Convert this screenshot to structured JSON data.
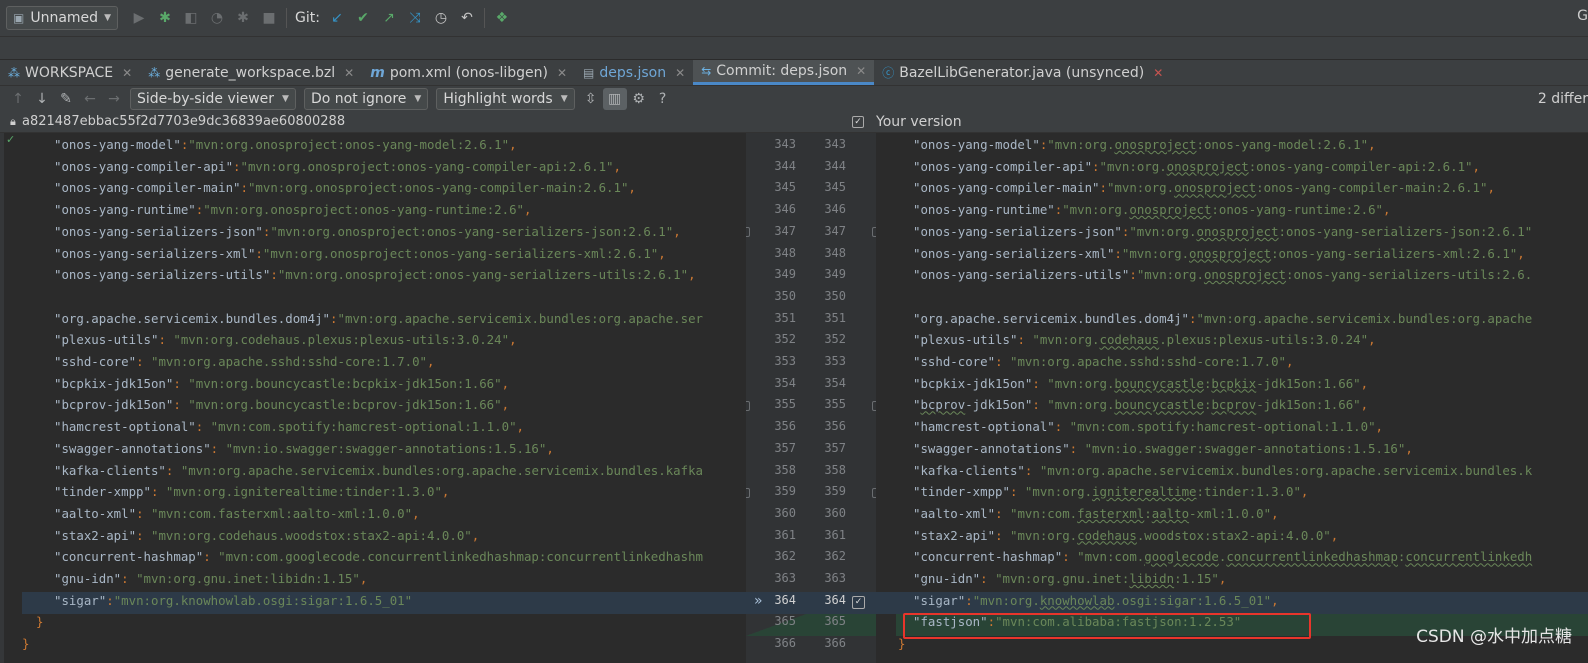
{
  "toolbar": {
    "run_config": "Unnamed",
    "git_label": "Git:"
  },
  "tabs": [
    {
      "label": "WORKSPACE",
      "icon": "bazel-icon",
      "active": false
    },
    {
      "label": "generate_workspace.bzl",
      "icon": "bazel-icon",
      "active": false
    },
    {
      "label": "pom.xml (onos-libgen)",
      "icon": "maven-icon",
      "active": false
    },
    {
      "label": "deps.json",
      "icon": "json-icon",
      "active": false
    },
    {
      "label": "Commit: deps.json",
      "icon": "diff-icon",
      "active": true
    },
    {
      "label": "BazelLibGenerator.java (unsynced)",
      "icon": "java-class-icon",
      "active": false
    }
  ],
  "diff_toolbar": {
    "viewer": "Side-by-side viewer",
    "ignore": "Do not ignore",
    "highlight": "Highlight words",
    "help": "?",
    "differences": "2 differ"
  },
  "panes": {
    "left_title": "a821487ebbac55f2d7703e9dc36839ae60800288",
    "right_title": "Your version"
  },
  "left_lines": [
    [
      [
        "k",
        "\"onos-yang-model\""
      ],
      [
        "p",
        ":"
      ],
      [
        "s",
        "\"mvn:org.onosproject:onos-yang-model:2.6.1\""
      ],
      [
        "p",
        ","
      ]
    ],
    [
      [
        "k",
        "\"onos-yang-compiler-api\""
      ],
      [
        "p",
        ":"
      ],
      [
        "s",
        "\"mvn:org.onosproject:onos-yang-compiler-api:2.6.1\""
      ],
      [
        "p",
        ","
      ]
    ],
    [
      [
        "k",
        "\"onos-yang-compiler-main\""
      ],
      [
        "p",
        ":"
      ],
      [
        "s",
        "\"mvn:org.onosproject:onos-yang-compiler-main:2.6.1\""
      ],
      [
        "p",
        ","
      ]
    ],
    [
      [
        "k",
        "\"onos-yang-runtime\""
      ],
      [
        "p",
        ":"
      ],
      [
        "s",
        "\"mvn:org.onosproject:onos-yang-runtime:2.6\""
      ],
      [
        "p",
        ","
      ]
    ],
    [
      [
        "k",
        "\"onos-yang-serializers-json\""
      ],
      [
        "p",
        ":"
      ],
      [
        "s",
        "\"mvn:org.onosproject:onos-yang-serializers-json:2.6.1\""
      ],
      [
        "p",
        ","
      ]
    ],
    [
      [
        "k",
        "\"onos-yang-serializers-xml\""
      ],
      [
        "p",
        ":"
      ],
      [
        "s",
        "\"mvn:org.onosproject:onos-yang-serializers-xml:2.6.1\""
      ],
      [
        "p",
        ","
      ]
    ],
    [
      [
        "k",
        "\"onos-yang-serializers-utils\""
      ],
      [
        "p",
        ":"
      ],
      [
        "s",
        "\"mvn:org.onosproject:onos-yang-serializers-utils:2.6.1\""
      ],
      [
        "p",
        ","
      ]
    ],
    [],
    [
      [
        "k",
        "\"org.apache.servicemix.bundles.dom4j\""
      ],
      [
        "p",
        ":"
      ],
      [
        "s",
        "\"mvn:org.apache.servicemix.bundles:org.apache.ser"
      ]
    ],
    [
      [
        "k",
        "\"plexus-utils\""
      ],
      [
        "p",
        ": "
      ],
      [
        "s",
        "\"mvn:org.codehaus.plexus:plexus-utils:3.0.24\""
      ],
      [
        "p",
        ","
      ]
    ],
    [
      [
        "k",
        "\"sshd-core\""
      ],
      [
        "p",
        ": "
      ],
      [
        "s",
        "\"mvn:org.apache.sshd:sshd-core:1.7.0\""
      ],
      [
        "p",
        ","
      ]
    ],
    [
      [
        "k",
        "\"bcpkix-jdk15on\""
      ],
      [
        "p",
        ": "
      ],
      [
        "s",
        "\"mvn:org.bouncycastle:bcpkix-jdk15on:1.66\""
      ],
      [
        "p",
        ","
      ]
    ],
    [
      [
        "k",
        "\"bcprov-jdk15on\""
      ],
      [
        "p",
        ": "
      ],
      [
        "s",
        "\"mvn:org.bouncycastle:bcprov-jdk15on:1.66\""
      ],
      [
        "p",
        ","
      ]
    ],
    [
      [
        "k",
        "\"hamcrest-optional\""
      ],
      [
        "p",
        ": "
      ],
      [
        "s",
        "\"mvn:com.spotify:hamcrest-optional:1.1.0\""
      ],
      [
        "p",
        ","
      ]
    ],
    [
      [
        "k",
        "\"swagger-annotations\""
      ],
      [
        "p",
        ": "
      ],
      [
        "s",
        "\"mvn:io.swagger:swagger-annotations:1.5.16\""
      ],
      [
        "p",
        ","
      ]
    ],
    [
      [
        "k",
        "\"kafka-clients\""
      ],
      [
        "p",
        ": "
      ],
      [
        "s",
        "\"mvn:org.apache.servicemix.bundles:org.apache.servicemix.bundles.kafka"
      ]
    ],
    [
      [
        "k",
        "\"tinder-xmpp\""
      ],
      [
        "p",
        ": "
      ],
      [
        "s",
        "\"mvn:org.igniterealtime:tinder:1.3.0\""
      ],
      [
        "p",
        ","
      ]
    ],
    [
      [
        "k",
        "\"aalto-xml\""
      ],
      [
        "p",
        ": "
      ],
      [
        "s",
        "\"mvn:com.fasterxml:aalto-xml:1.0.0\""
      ],
      [
        "p",
        ","
      ]
    ],
    [
      [
        "k",
        "\"stax2-api\""
      ],
      [
        "p",
        ": "
      ],
      [
        "s",
        "\"mvn:org.codehaus.woodstox:stax2-api:4.0.0\""
      ],
      [
        "p",
        ","
      ]
    ],
    [
      [
        "k",
        "\"concurrent-hashmap\""
      ],
      [
        "p",
        ": "
      ],
      [
        "s",
        "\"mvn:com.googlecode.concurrentlinkedhashmap:concurrentlinkedhashm"
      ]
    ],
    [
      [
        "k",
        "\"gnu-idn\""
      ],
      [
        "p",
        ": "
      ],
      [
        "s",
        "\"mvn:org.gnu.inet:libidn:1.15\""
      ],
      [
        "p",
        ","
      ]
    ],
    [
      [
        "k",
        "\"sigar\""
      ],
      [
        "p",
        ":"
      ],
      [
        "s",
        "\"mvn:org.knowhowlab.osgi:sigar:1.6.5_01\""
      ]
    ],
    [
      [
        "p",
        "}"
      ]
    ],
    [
      [
        "p",
        "}"
      ]
    ]
  ],
  "right_lines": [
    [
      [
        "k",
        "\"onos-yang-model\""
      ],
      [
        "p",
        ":"
      ],
      [
        "s",
        "\"mvn:org."
      ],
      [
        "su",
        "onosproject"
      ],
      [
        "s",
        ":onos-yang-model:2.6.1\""
      ],
      [
        "p",
        ","
      ]
    ],
    [
      [
        "k",
        "\"onos-yang-compiler-api\""
      ],
      [
        "p",
        ":"
      ],
      [
        "s",
        "\"mvn:org."
      ],
      [
        "su",
        "onosproject"
      ],
      [
        "s",
        ":onos-yang-compiler-api:2.6.1\""
      ],
      [
        "p",
        ","
      ]
    ],
    [
      [
        "k",
        "\"onos-yang-compiler-main\""
      ],
      [
        "p",
        ":"
      ],
      [
        "s",
        "\"mvn:org."
      ],
      [
        "su",
        "onosproject"
      ],
      [
        "s",
        ":onos-yang-compiler-main:2.6.1\""
      ],
      [
        "p",
        ","
      ]
    ],
    [
      [
        "k",
        "\"onos-yang-runtime\""
      ],
      [
        "p",
        ":"
      ],
      [
        "s",
        "\"mvn:org."
      ],
      [
        "su",
        "onosproject"
      ],
      [
        "s",
        ":onos-yang-runtime:2.6\""
      ],
      [
        "p",
        ","
      ]
    ],
    [
      [
        "k",
        "\"onos-yang-serializers-json\""
      ],
      [
        "p",
        ":"
      ],
      [
        "s",
        "\"mvn:org."
      ],
      [
        "su",
        "onosproject"
      ],
      [
        "s",
        ":onos-yang-serializers-json:2.6.1\""
      ]
    ],
    [
      [
        "k",
        "\"onos-yang-serializers-xml\""
      ],
      [
        "p",
        ":"
      ],
      [
        "s",
        "\"mvn:org."
      ],
      [
        "su",
        "onosproject"
      ],
      [
        "s",
        ":onos-yang-serializers-xml:2.6.1\""
      ],
      [
        "p",
        ","
      ]
    ],
    [
      [
        "k",
        "\"onos-yang-serializers-utils\""
      ],
      [
        "p",
        ":"
      ],
      [
        "s",
        "\"mvn:org."
      ],
      [
        "su",
        "onosproject"
      ],
      [
        "s",
        ":onos-yang-serializers-utils:2.6."
      ]
    ],
    [],
    [
      [
        "k",
        "\"org.apache.servicemix.bundles.dom4j\""
      ],
      [
        "p",
        ":"
      ],
      [
        "s",
        "\"mvn:org.apache.servicemix.bundles:org.apache"
      ]
    ],
    [
      [
        "k",
        "\"plexus-utils\""
      ],
      [
        "p",
        ": "
      ],
      [
        "s",
        "\"mvn:org."
      ],
      [
        "su",
        "codehaus"
      ],
      [
        "s",
        ".plexus:plexus-utils:3.0.24\""
      ],
      [
        "p",
        ","
      ]
    ],
    [
      [
        "k",
        "\"sshd-core\""
      ],
      [
        "p",
        ": "
      ],
      [
        "s",
        "\"mvn:org.apache.sshd:sshd-core:1.7.0\""
      ],
      [
        "p",
        ","
      ]
    ],
    [
      [
        "k",
        "\"bcpkix-jdk15on\""
      ],
      [
        "p",
        ": "
      ],
      [
        "s",
        "\"mvn:org."
      ],
      [
        "su",
        "bouncycastle"
      ],
      [
        "s",
        ":"
      ],
      [
        "su",
        "bcpkix"
      ],
      [
        "s",
        "-jdk15on:1.66\""
      ],
      [
        "p",
        ","
      ]
    ],
    [
      [
        "k",
        "\""
      ],
      [
        "ku",
        "bcprov"
      ],
      [
        "k",
        "-jdk15on\""
      ],
      [
        "p",
        ": "
      ],
      [
        "s",
        "\"mvn:org."
      ],
      [
        "su",
        "bouncycastle"
      ],
      [
        "s",
        ":"
      ],
      [
        "su",
        "bcprov"
      ],
      [
        "s",
        "-jdk15on:1.66\""
      ],
      [
        "p",
        ","
      ]
    ],
    [
      [
        "k",
        "\"hamcrest-optional\""
      ],
      [
        "p",
        ": "
      ],
      [
        "s",
        "\"mvn:com.spotify:hamcrest-optional:1.1.0\""
      ],
      [
        "p",
        ","
      ]
    ],
    [
      [
        "k",
        "\"swagger-annotations\""
      ],
      [
        "p",
        ": "
      ],
      [
        "s",
        "\"mvn:io.swagger:swagger-annotations:1.5.16\""
      ],
      [
        "p",
        ","
      ]
    ],
    [
      [
        "k",
        "\"kafka-clients\""
      ],
      [
        "p",
        ": "
      ],
      [
        "s",
        "\"mvn:org.apache.servicemix.bundles:org.apache.servicemix.bundles.k"
      ]
    ],
    [
      [
        "k",
        "\"tinder-xmpp\""
      ],
      [
        "p",
        ": "
      ],
      [
        "s",
        "\"mvn:org."
      ],
      [
        "su",
        "igniterealtime"
      ],
      [
        "s",
        ":tinder:1.3.0\""
      ],
      [
        "p",
        ","
      ]
    ],
    [
      [
        "k",
        "\"aalto-xml\""
      ],
      [
        "p",
        ": "
      ],
      [
        "s",
        "\"mvn:com."
      ],
      [
        "su",
        "fasterxml"
      ],
      [
        "s",
        ":"
      ],
      [
        "su",
        "aalto"
      ],
      [
        "s",
        "-xml:1.0.0\""
      ],
      [
        "p",
        ","
      ]
    ],
    [
      [
        "k",
        "\"stax2-api\""
      ],
      [
        "p",
        ": "
      ],
      [
        "s",
        "\"mvn:org."
      ],
      [
        "su",
        "codehaus"
      ],
      [
        "s",
        ".woodstox:stax2-api:4.0.0\""
      ],
      [
        "p",
        ","
      ]
    ],
    [
      [
        "k",
        "\"concurrent-hashmap\""
      ],
      [
        "p",
        ": "
      ],
      [
        "s",
        "\"mvn:com."
      ],
      [
        "su",
        "googlecode"
      ],
      [
        "s",
        "."
      ],
      [
        "su",
        "concurrentlinkedhashmap"
      ],
      [
        "s",
        ":"
      ],
      [
        "su",
        "concurrentlinkedh"
      ]
    ],
    [
      [
        "k",
        "\"gnu-idn\""
      ],
      [
        "p",
        ": "
      ],
      [
        "s",
        "\"mvn:org.gnu.inet:"
      ],
      [
        "su",
        "libidn"
      ],
      [
        "s",
        ":1.15\""
      ],
      [
        "p",
        ","
      ]
    ],
    [
      [
        "k",
        "\"sigar\""
      ],
      [
        "p",
        ":"
      ],
      [
        "s",
        "\"mvn:org."
      ],
      [
        "su",
        "knowhowlab"
      ],
      [
        "s",
        ".osgi:sigar:1.6.5_01\""
      ],
      [
        "p",
        ","
      ]
    ],
    [
      [
        "k",
        "\"fastjson\""
      ],
      [
        "p",
        ":"
      ],
      [
        "s",
        "\"mvn:com.alibaba:fastjson:1.2.53\""
      ]
    ],
    [
      [
        "p",
        "}"
      ]
    ]
  ],
  "left_line_numbers": [
    "343",
    "344",
    "345",
    "346",
    "347",
    "348",
    "349",
    "350",
    "351",
    "352",
    "353",
    "354",
    "355",
    "356",
    "357",
    "358",
    "359",
    "360",
    "361",
    "362",
    "363",
    "364",
    "365",
    "366"
  ],
  "right_line_numbers": [
    "343",
    "344",
    "345",
    "346",
    "347",
    "348",
    "349",
    "350",
    "351",
    "352",
    "353",
    "354",
    "355",
    "356",
    "357",
    "358",
    "359",
    "360",
    "361",
    "362",
    "363",
    "364",
    "365",
    "366"
  ],
  "watermark": "CSDN @水中加点糖",
  "colors": {
    "key": "#a9b7c6",
    "string": "#6a8759",
    "punct": "#cc7832",
    "changed_bg": "#2d3a48",
    "inserted_bg": "#294436",
    "highlight_box": "#e8352b"
  }
}
